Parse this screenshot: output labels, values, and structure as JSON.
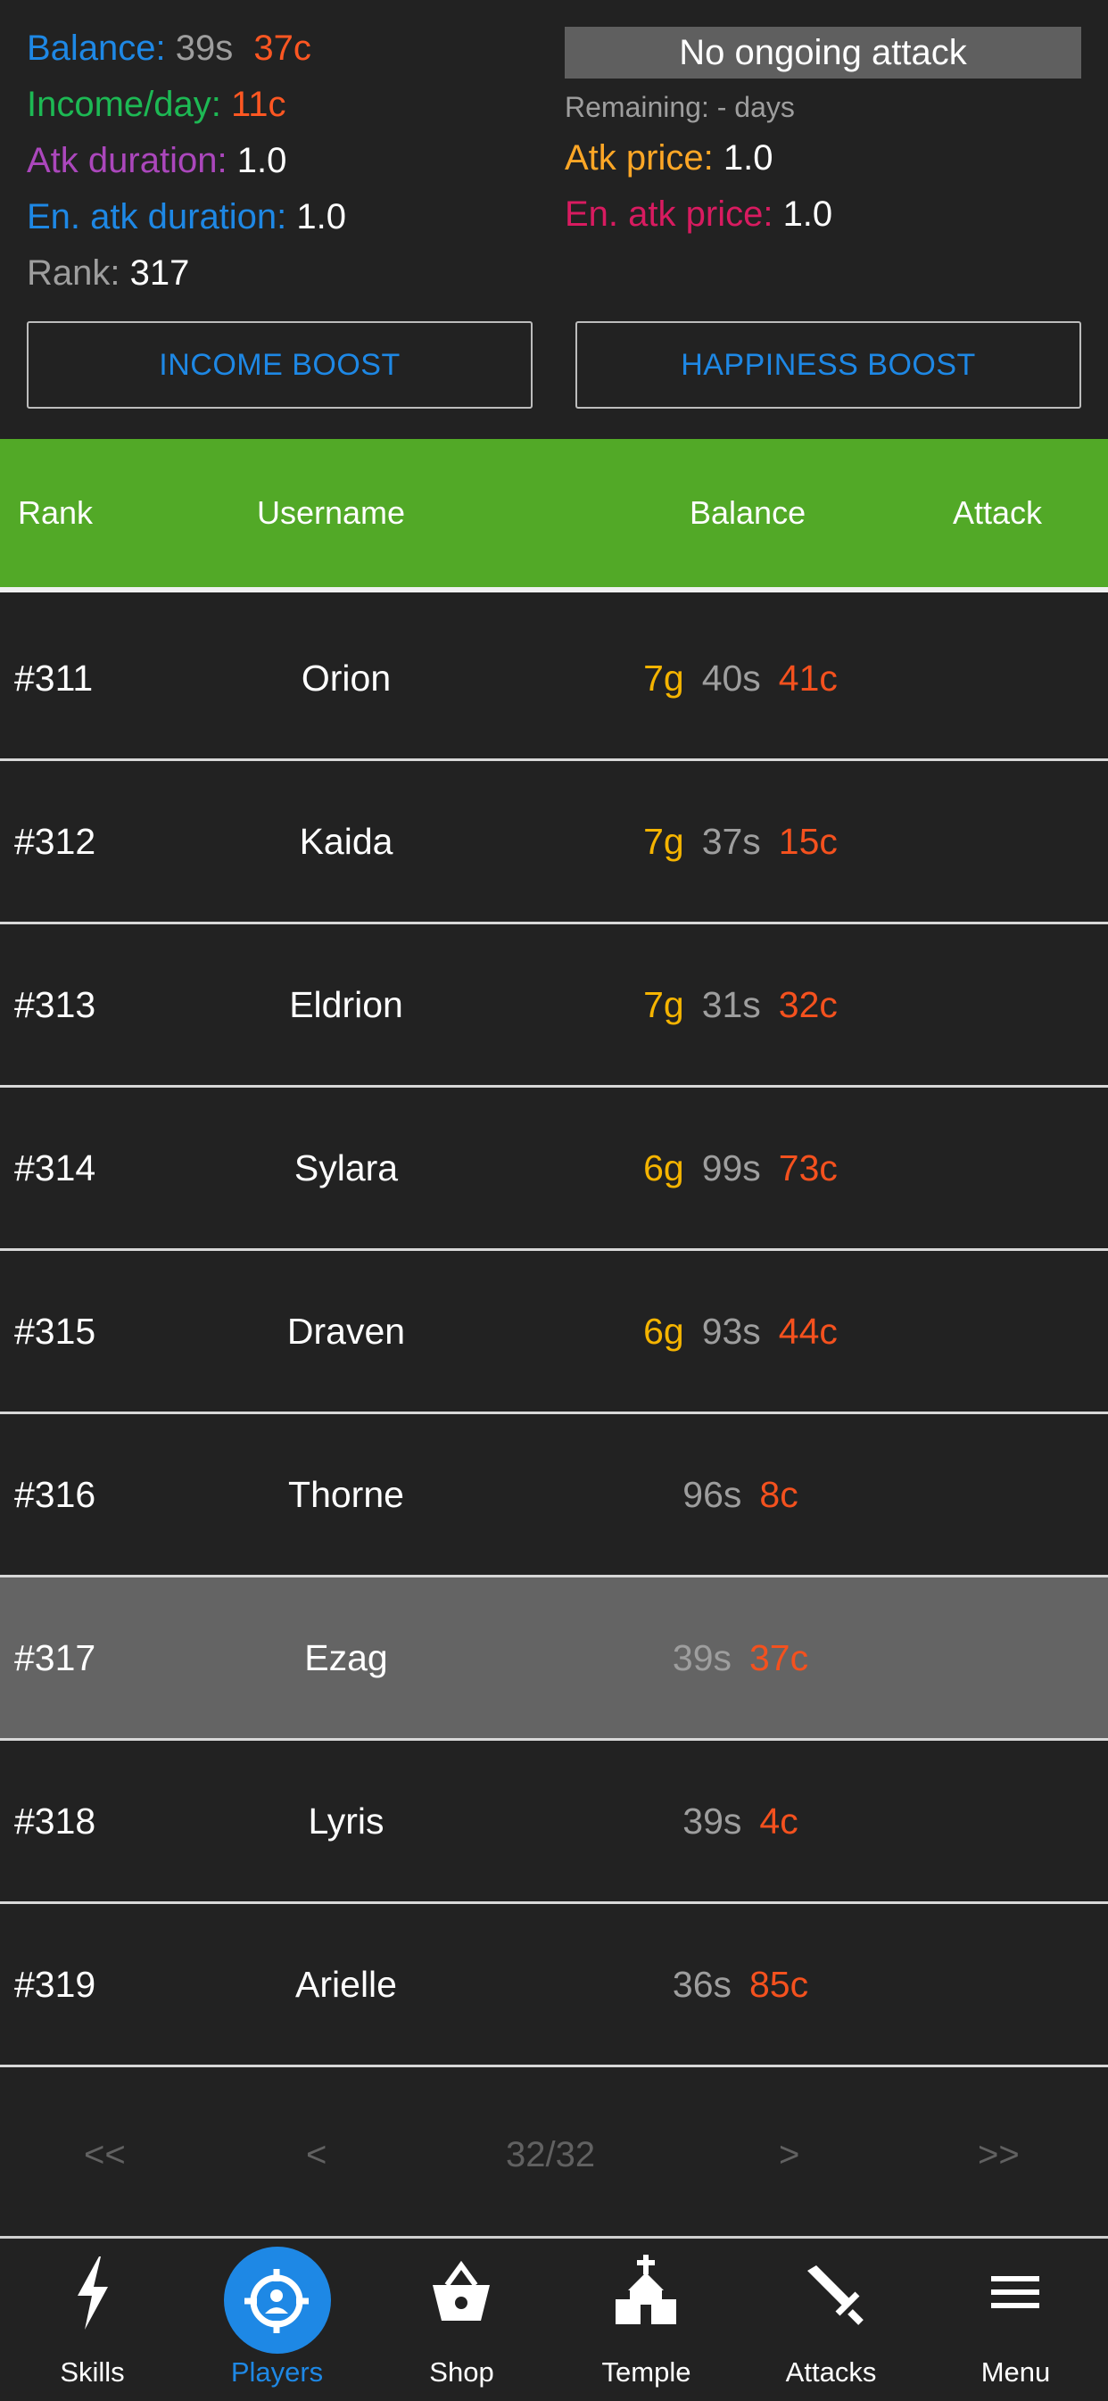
{
  "stats": {
    "balance_label": "Balance:",
    "balance_silver": "39s",
    "balance_copper": "37c",
    "income_label": "Income/day:",
    "income_value": "11c",
    "atk_duration_label": "Atk duration:",
    "atk_duration_value": "1.0",
    "en_atk_duration_label": "En. atk duration:",
    "en_atk_duration_value": "1.0",
    "rank_label": "Rank:",
    "rank_value": "317"
  },
  "attack": {
    "status": "No ongoing attack",
    "remaining": "Remaining: - days",
    "atk_price_label": "Atk price:",
    "atk_price_value": "1.0",
    "en_atk_price_label": "En. atk price:",
    "en_atk_price_value": "1.0"
  },
  "buttons": {
    "income_boost": "INCOME BOOST",
    "happiness_boost": "HAPPINESS BOOST"
  },
  "table": {
    "headers": {
      "rank": "Rank",
      "username": "Username",
      "balance": "Balance",
      "attack": "Attack"
    },
    "rows": [
      {
        "rank": "#311",
        "username": "Orion",
        "gold": "7g",
        "silver": "40s",
        "copper": "41c"
      },
      {
        "rank": "#312",
        "username": "Kaida",
        "gold": "7g",
        "silver": "37s",
        "copper": "15c"
      },
      {
        "rank": "#313",
        "username": "Eldrion",
        "gold": "7g",
        "silver": "31s",
        "copper": "32c"
      },
      {
        "rank": "#314",
        "username": "Sylara",
        "gold": "6g",
        "silver": "99s",
        "copper": "73c"
      },
      {
        "rank": "#315",
        "username": "Draven",
        "gold": "6g",
        "silver": "93s",
        "copper": "44c"
      },
      {
        "rank": "#316",
        "username": "Thorne",
        "gold": "",
        "silver": "96s",
        "copper": "8c"
      },
      {
        "rank": "#317",
        "username": "Ezag",
        "gold": "",
        "silver": "39s",
        "copper": "37c"
      },
      {
        "rank": "#318",
        "username": "Lyris",
        "gold": "",
        "silver": "39s",
        "copper": "4c"
      },
      {
        "rank": "#319",
        "username": "Arielle",
        "gold": "",
        "silver": "36s",
        "copper": "85c"
      }
    ]
  },
  "pagination": {
    "first": "<<",
    "prev": "<",
    "page": "32/32",
    "next": ">",
    "last": ">>"
  },
  "nav": [
    {
      "label": "Skills",
      "icon": "lightning-icon"
    },
    {
      "label": "Players",
      "icon": "crosshair-person-icon"
    },
    {
      "label": "Shop",
      "icon": "basket-icon"
    },
    {
      "label": "Temple",
      "icon": "church-icon"
    },
    {
      "label": "Attacks",
      "icon": "sword-icon"
    },
    {
      "label": "Menu",
      "icon": "hamburger-menu-icon"
    }
  ],
  "colors": {
    "header_green": "#52a927",
    "accent_blue": "#1e88e5",
    "gold": "#f5b400",
    "silver": "#9e9e9e",
    "copper": "#f4511e",
    "self_row": "#646464"
  }
}
